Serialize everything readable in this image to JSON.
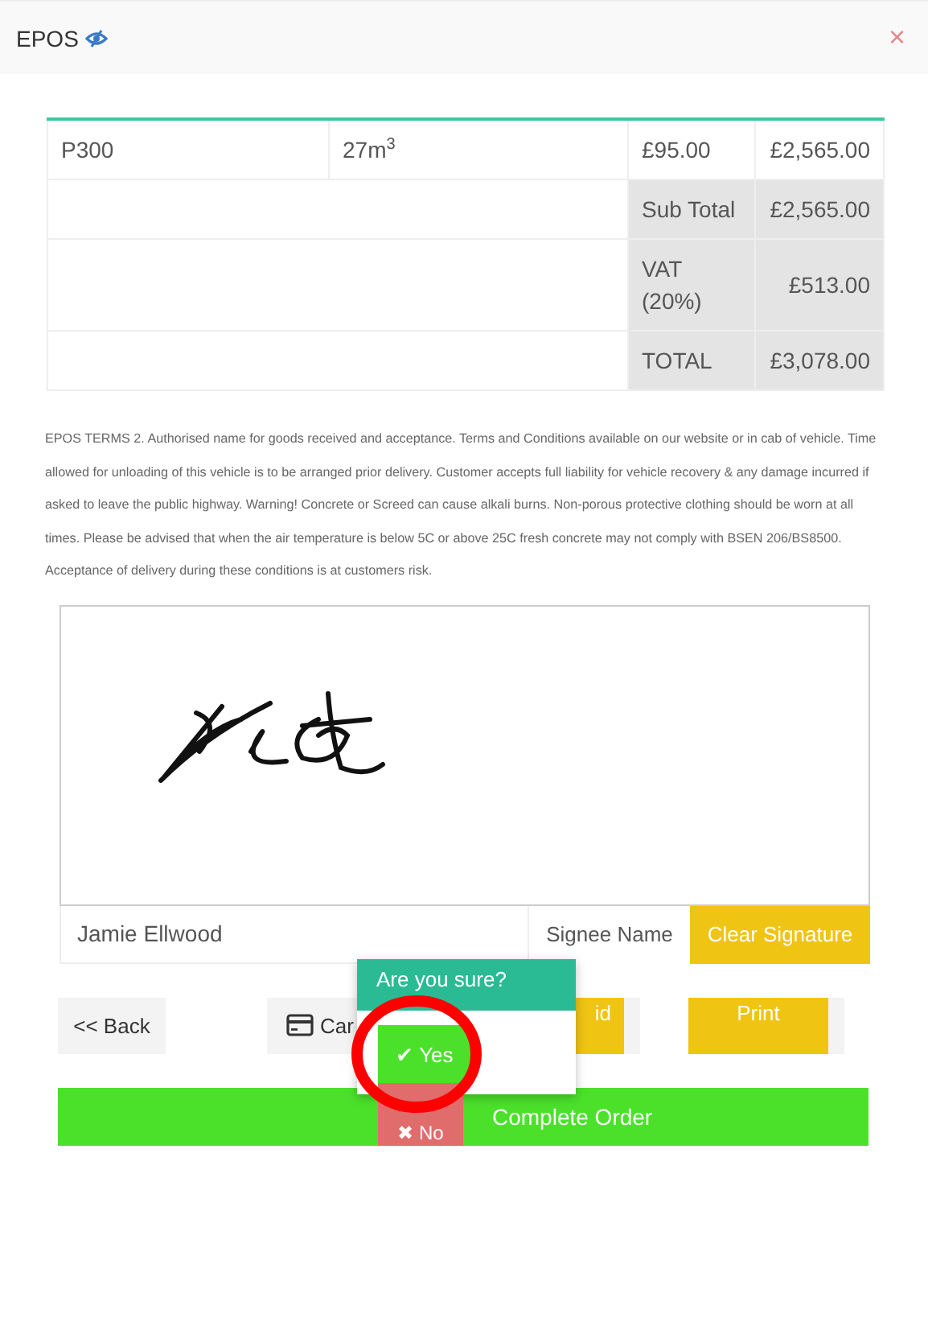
{
  "header": {
    "title": "EPOS",
    "close": "×"
  },
  "table": {
    "rows": [
      {
        "kind": "item",
        "cells": [
          "P300",
          "27m$^{3}$",
          "£95.00",
          "£2,565.00"
        ]
      },
      {
        "kind": "summary",
        "label": "Sub Total",
        "value": "£2,565.00"
      },
      {
        "kind": "summary",
        "label": "VAT (20%)",
        "value": "£513.00"
      },
      {
        "kind": "summary",
        "label": "TOTAL",
        "value": "£3,078.00"
      }
    ]
  },
  "terms": "EPOS TERMS 2. Authorised name for goods received and acceptance. Terms and Conditions available on our website or in cab of vehicle. Time allowed for unloading of this vehicle is to be arranged prior delivery. Customer accepts full liability for vehicle recovery & any damage incurred if asked to leave the public highway. Warning! Concrete or Screed can cause alkali burns. Non-porous protective clothing should be worn at all times. Please be advised that when the air temperature is below 5C or above 25C fresh concrete may not comply with BSEN 206/BS8500. Acceptance of delivery during these conditions is at customers risk.",
  "signature": {
    "name_value": "Jamie Ellwood",
    "name_label": "Signee Name",
    "clear_button": "Clear Signature"
  },
  "buttons": [
    {
      "kind": "back",
      "label": "<< Back"
    },
    {
      "kind": "card",
      "label": "Car"
    },
    {
      "kind": "yellow",
      "label": "id"
    },
    {
      "kind": "yellow",
      "label": "Print"
    }
  ],
  "confirm": {
    "title": "Are you sure?",
    "yes": "✔ Yes",
    "no": "✖ No"
  },
  "complete_button": "Complete Order"
}
